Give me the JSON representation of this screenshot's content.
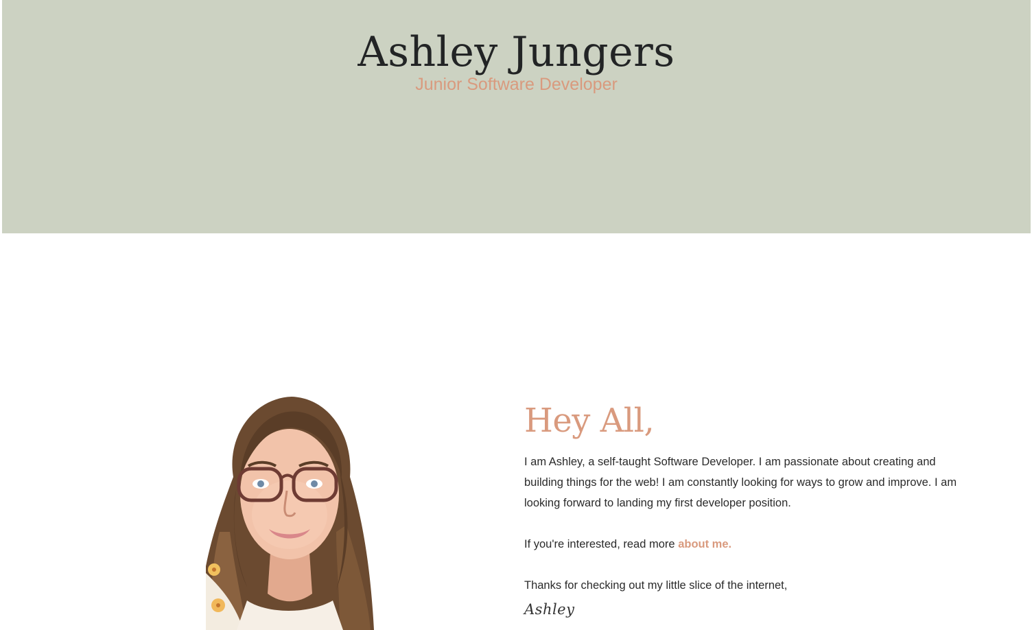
{
  "header": {
    "name": "Ashley Jungers",
    "title": "Junior Software Developer"
  },
  "intro": {
    "heading": "Hey All,",
    "paragraph1": "I am Ashley, a self-taught Software Developer. I am passionate about creating and building things for the web! I am constantly looking for ways to grow and improve. I am looking forward to landing my first developer position.",
    "paragraph2_prefix": "If you're interested, read more ",
    "about_link": "about me.",
    "paragraph3": "Thanks for checking out my little slice of the internet,",
    "signature": "Ashley"
  },
  "colors": {
    "hero_background": "#ccd2c2",
    "accent": "#d99a7e",
    "text": "#2a2a2a"
  },
  "images": {
    "portrait": "illustrated-portrait"
  }
}
